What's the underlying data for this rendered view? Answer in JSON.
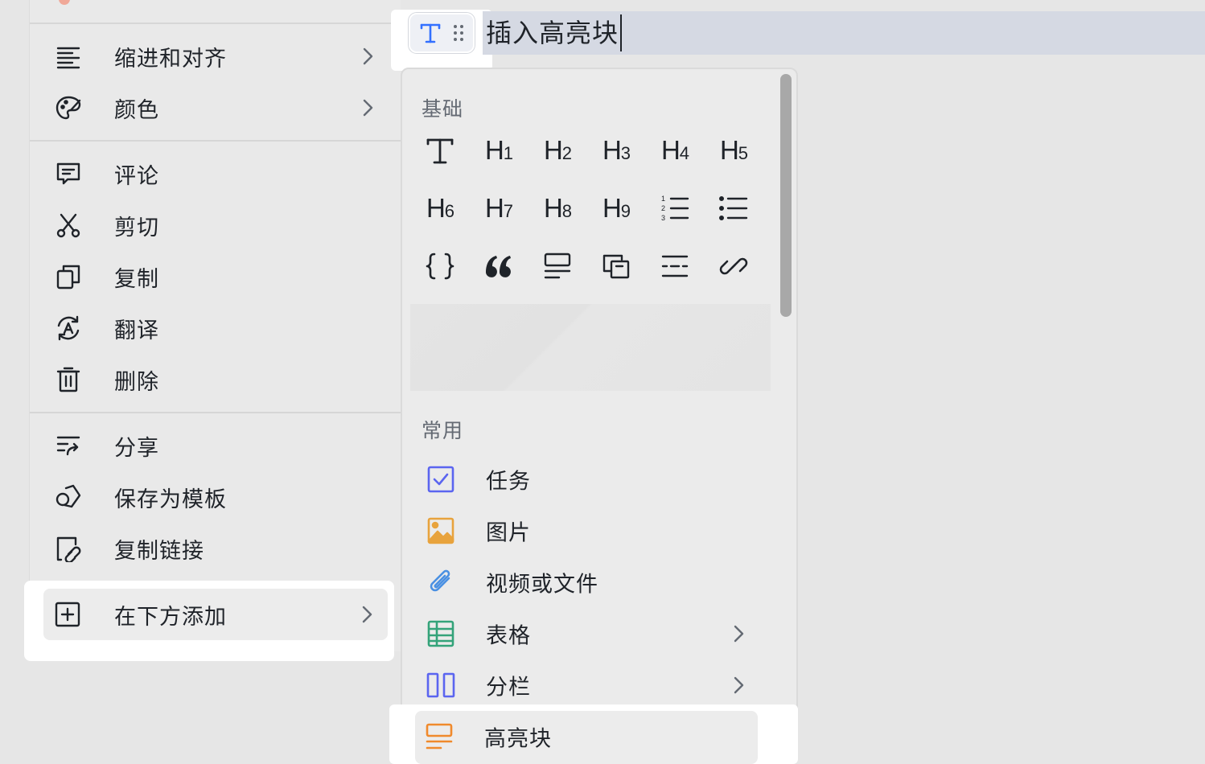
{
  "context_menu": {
    "items_group1": [
      {
        "label": "缩进和对齐",
        "icon": "align-left-icon",
        "has_submenu": true
      },
      {
        "label": "颜色",
        "icon": "palette-icon",
        "has_submenu": true
      }
    ],
    "items_group2": [
      {
        "label": "评论",
        "icon": "comment-icon"
      },
      {
        "label": "剪切",
        "icon": "scissors-icon"
      },
      {
        "label": "复制",
        "icon": "copy-icon"
      },
      {
        "label": "翻译",
        "icon": "translate-icon"
      },
      {
        "label": "删除",
        "icon": "trash-icon"
      }
    ],
    "items_group3": [
      {
        "label": "分享",
        "icon": "share-icon"
      },
      {
        "label": "保存为模板",
        "icon": "template-icon"
      },
      {
        "label": "复制链接",
        "icon": "copy-link-icon"
      }
    ],
    "add_below": {
      "label": "在下方添加",
      "icon": "plus-square-icon",
      "has_submenu": true
    }
  },
  "editor": {
    "block_type_icon": "text-icon",
    "drag_handle_icon": "drag-dots-icon",
    "title_text": "插入高亮块"
  },
  "insert_panel": {
    "basic_section_title": "基础",
    "basic_blocks": [
      {
        "name": "text",
        "icon": "text-icon"
      },
      {
        "name": "h1",
        "glyph": "H",
        "sub": "1"
      },
      {
        "name": "h2",
        "glyph": "H",
        "sub": "2"
      },
      {
        "name": "h3",
        "glyph": "H",
        "sub": "3"
      },
      {
        "name": "h4",
        "glyph": "H",
        "sub": "4"
      },
      {
        "name": "h5",
        "glyph": "H",
        "sub": "5"
      },
      {
        "name": "h6",
        "glyph": "H",
        "sub": "6"
      },
      {
        "name": "h7",
        "glyph": "H",
        "sub": "7"
      },
      {
        "name": "h8",
        "glyph": "H",
        "sub": "8"
      },
      {
        "name": "h9",
        "glyph": "H",
        "sub": "9"
      },
      {
        "name": "ordered-list",
        "icon": "ordered-list-icon"
      },
      {
        "name": "bullet-list",
        "icon": "bullet-list-icon"
      },
      {
        "name": "code",
        "icon": "code-braces-icon"
      },
      {
        "name": "quote",
        "icon": "quote-icon"
      },
      {
        "name": "callout",
        "icon": "callout-icon"
      },
      {
        "name": "synced-block",
        "icon": "synced-block-icon"
      },
      {
        "name": "divider",
        "icon": "divider-icon"
      },
      {
        "name": "link",
        "icon": "link-icon"
      }
    ],
    "common_section_title": "常用",
    "common_items": [
      {
        "label": "任务",
        "icon": "task-checkbox-icon",
        "color": "#5b65f0",
        "has_submenu": false
      },
      {
        "label": "图片",
        "icon": "image-icon",
        "color": "#e8a33d",
        "has_submenu": false
      },
      {
        "label": "视频或文件",
        "icon": "paperclip-icon",
        "color": "#4a90e2",
        "has_submenu": false
      },
      {
        "label": "表格",
        "icon": "table-icon",
        "color": "#34a37a",
        "has_submenu": true
      },
      {
        "label": "分栏",
        "icon": "columns-icon",
        "color": "#5b65f0",
        "has_submenu": true
      },
      {
        "label": "高亮块",
        "icon": "highlight-block-icon",
        "color": "#f08a2c",
        "has_submenu": false
      }
    ]
  },
  "colors": {
    "accent_blue": "#3370ff",
    "selection_bg": "#d5d9e3",
    "text_primary": "#1f2329",
    "text_secondary": "#646a73"
  }
}
